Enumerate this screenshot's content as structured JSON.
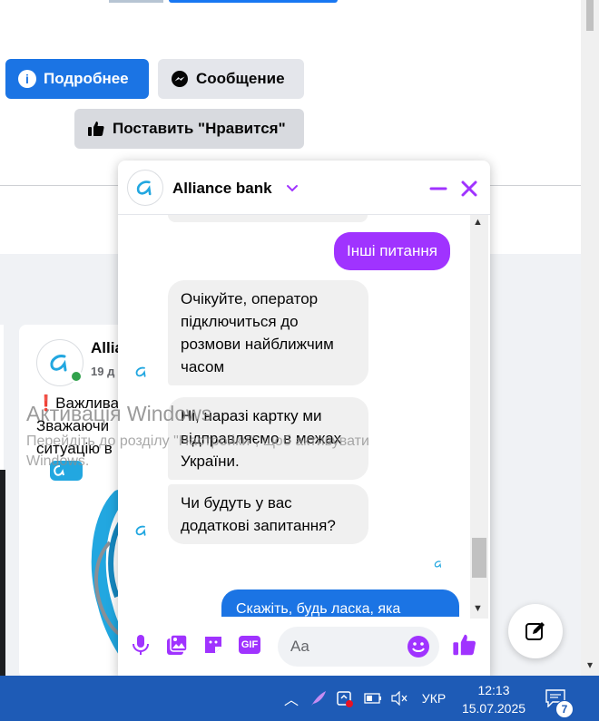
{
  "page": {
    "more_button": "Подробнее",
    "message_button": "Сообщение",
    "like_button": "Поставить \"Нравится\""
  },
  "post": {
    "author": "Allia",
    "date": "19 д",
    "text_lines": [
      "❗Важлива",
      "Зважаючи",
      "ситуацію в"
    ]
  },
  "chat": {
    "title": "Alliance bank",
    "messages": [
      {
        "from": "me",
        "text": "Інші питання"
      },
      {
        "from": "them",
        "text": "Очікуйте, оператор підключиться до розмови найближчим часом"
      },
      {
        "from": "them",
        "text": "Ні, наразі картку ми відправляємо в межах України."
      },
      {
        "from": "them",
        "text": "Чи будуть у вас додаткові запитання?"
      }
    ],
    "input_placeholder": "Aa",
    "gif_label": "GIF",
    "peek_text": "Скажіть, будь ласка, яка"
  },
  "watermark": {
    "title": "Активація Windows",
    "line1": "Перейдіть до розділу \"Настройки\", щоб активувати",
    "line2": "Windows."
  },
  "taskbar": {
    "language": "УКР",
    "time": "12:13",
    "date": "15.07.2025",
    "notification_count": "7"
  },
  "colors": {
    "facebook_blue": "#1b74e4",
    "messenger_purple": "#a033ff",
    "taskbar": "#1e5bb6"
  }
}
